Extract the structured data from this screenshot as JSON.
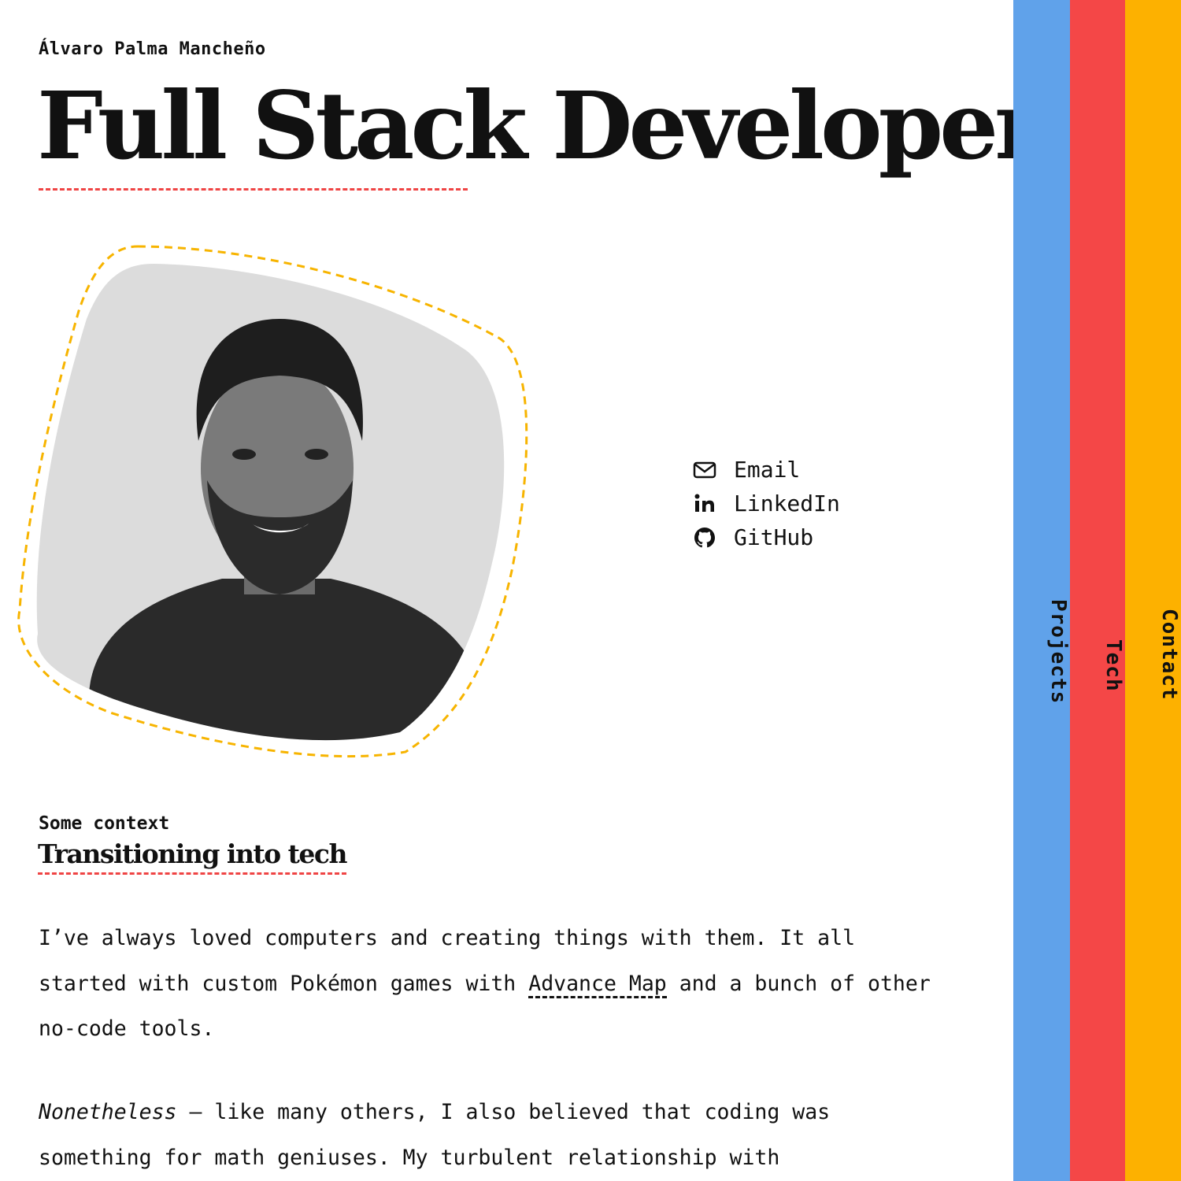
{
  "header": {
    "author_name": "Álvaro Palma Mancheño",
    "title": "Full Stack Developer"
  },
  "colors": {
    "accent_red": "#ef4444",
    "accent_yellow": "#f7b400",
    "tab_projects": "#60a2ea",
    "tab_tech": "#f44747",
    "tab_contact": "#fdb100"
  },
  "social": [
    {
      "label": "Email",
      "icon": "envelope-icon"
    },
    {
      "label": "LinkedIn",
      "icon": "linkedin-icon"
    },
    {
      "label": "GitHub",
      "icon": "github-icon"
    }
  ],
  "section": {
    "eyebrow": "Some context",
    "heading": "Transitioning into tech"
  },
  "paragraph1": {
    "text_before": "I’ve always loved computers and creating things with them. It all started with custom Pokémon games with ",
    "link": "Advance Map",
    "text_after": " and a bunch of other no-code tools."
  },
  "paragraph2": {
    "emphasis": "Nonetheless",
    "text": " — like many others, I also believed that coding was something for math geniuses. My turbulent relationship with"
  },
  "nav_tabs": [
    "Projects",
    "Tech",
    "Contact"
  ]
}
